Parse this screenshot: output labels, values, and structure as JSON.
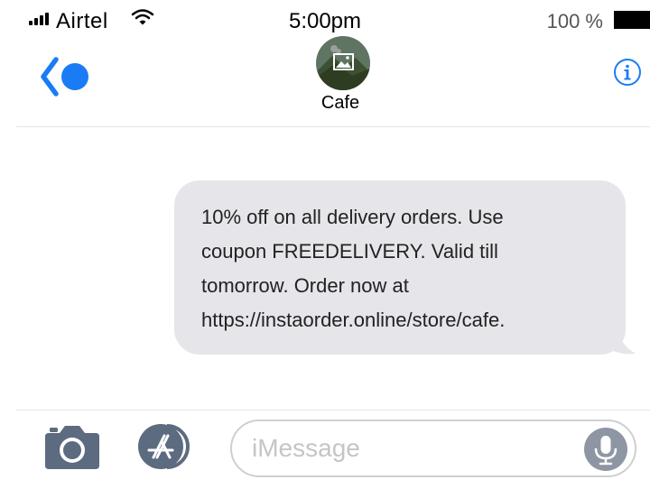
{
  "status_bar": {
    "carrier": "Airtel",
    "time": "5:00pm",
    "battery": "100 %"
  },
  "header": {
    "contact_name": "Cafe"
  },
  "message": {
    "lines": [
      "10% off on all delivery orders. Use",
      "coupon FREEDELIVERY. Valid till",
      "tomorrow. Order now at",
      "https://instaorder.online/store/cafe."
    ]
  },
  "compose": {
    "placeholder": "iMessage"
  },
  "colors": {
    "accent": "#1a7cf5",
    "bubble_received": "#e5e5ea",
    "icon_gray": "#5d6b80"
  },
  "icons": [
    "signal-icon",
    "wifi-icon",
    "battery-icon",
    "back-icon",
    "avatar",
    "info-icon",
    "camera-icon",
    "app-store-icon",
    "microphone-icon"
  ]
}
